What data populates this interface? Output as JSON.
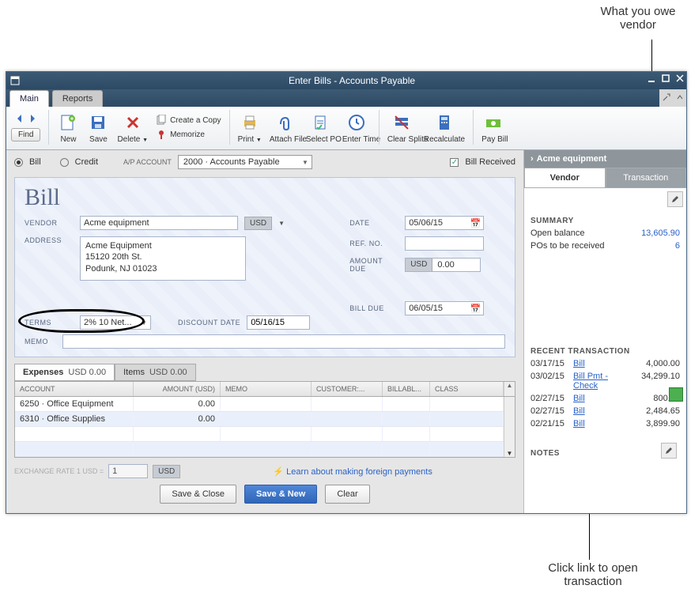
{
  "callouts": {
    "top": "What you owe vendor",
    "bottom": "Click link to open transaction"
  },
  "window": {
    "title": "Enter Bills - Accounts Payable"
  },
  "ribbon": {
    "tabs": [
      "Main",
      "Reports"
    ]
  },
  "toolbar": {
    "find": "Find",
    "new": "New",
    "save": "Save",
    "delete": "Delete",
    "create_copy": "Create a Copy",
    "memorize": "Memorize",
    "print": "Print",
    "attach": "Attach File",
    "select_po": "Select PO",
    "enter_time": "Enter Time",
    "clear_splits": "Clear Splits",
    "recalculate": "Recalculate",
    "pay_bill": "Pay Bill"
  },
  "mode": {
    "bill": "Bill",
    "credit": "Credit",
    "ap_label": "A/P ACCOUNT",
    "ap_value": "2000 · Accounts Payable",
    "bill_received": "Bill Received"
  },
  "check": {
    "title": "Bill",
    "vendor_label": "VENDOR",
    "vendor_value": "Acme equipment",
    "currency": "USD",
    "address_label": "ADDRESS",
    "address_value": "Acme Equipment\n15120 20th St.\nPodunk, NJ 01023",
    "date_label": "DATE",
    "date_value": "05/06/15",
    "refno_label": "REF. NO.",
    "refno_value": "",
    "amount_due_label": "AMOUNT DUE",
    "amount_due_currency": "USD",
    "amount_due_value": "0.00",
    "billdue_label": "BILL DUE",
    "billdue_value": "06/05/15",
    "terms_label": "TERMS",
    "terms_value": "2% 10 Net...",
    "discount_label": "DISCOUNT DATE",
    "discount_value": "05/16/15",
    "memo_label": "MEMO",
    "memo_value": ""
  },
  "tabs": {
    "expenses_label": "Expenses",
    "expenses_amount": "USD  0.00",
    "items_label": "Items",
    "items_amount": "USD  0.00"
  },
  "table": {
    "headers": {
      "account": "ACCOUNT",
      "amount": "AMOUNT (USD)",
      "memo": "MEMO",
      "customer": "CUSTOMER:...",
      "billable": "BILLABL...",
      "class": "CLASS"
    },
    "rows": [
      {
        "account": "6250 · Office Equipment",
        "amount": "0.00",
        "memo": "",
        "customer": "",
        "billable": "",
        "class": ""
      },
      {
        "account": "6310 · Office Supplies",
        "amount": "0.00",
        "memo": "",
        "customer": "",
        "billable": "",
        "class": ""
      }
    ]
  },
  "bottom": {
    "ex_rate_label": "EXCHANGE RATE 1 USD =",
    "ex_rate_value": "1",
    "ex_rate_ccy": "USD",
    "learn_link": "Learn about making foreign payments",
    "save_close": "Save & Close",
    "save_new": "Save & New",
    "clear": "Clear"
  },
  "right": {
    "vendor_name": "Acme equipment",
    "tab_vendor": "Vendor",
    "tab_transaction": "Transaction",
    "summary_title": "SUMMARY",
    "open_balance_label": "Open balance",
    "open_balance_value": "13,605.90",
    "pos_label": "POs to be received",
    "pos_value": "6",
    "recent_title": "RECENT TRANSACTION",
    "transactions": [
      {
        "date": "03/17/15",
        "type": "Bill",
        "amount": "4,000.00"
      },
      {
        "date": "03/02/15",
        "type": "Bill Pmt -Check",
        "amount": "34,299.10"
      },
      {
        "date": "02/27/15",
        "type": "Bill",
        "amount": "800.00"
      },
      {
        "date": "02/27/15",
        "type": "Bill",
        "amount": "2,484.65"
      },
      {
        "date": "02/21/15",
        "type": "Bill",
        "amount": "3,899.90"
      }
    ],
    "notes_title": "NOTES"
  }
}
